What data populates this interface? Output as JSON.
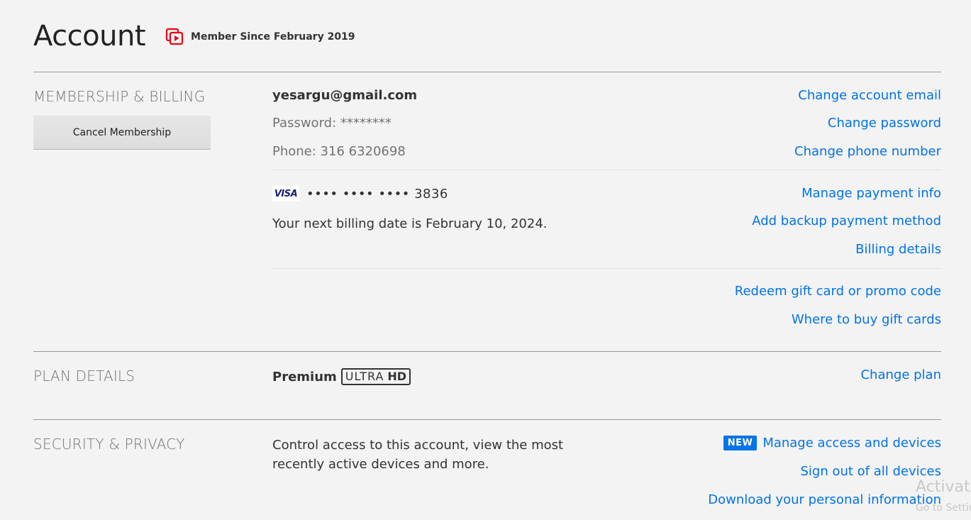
{
  "header": {
    "title": "Account",
    "member_since": "Member Since February 2019",
    "member_icon": "member-since-icon"
  },
  "membership": {
    "section_title": "MEMBERSHIP & BILLING",
    "cancel_label": "Cancel Membership",
    "email": "yesargu@gmail.com",
    "password": "Password: ********",
    "phone": "Phone: 316 6320698",
    "links": {
      "change_email": "Change account email",
      "change_password": "Change password",
      "change_phone": "Change phone number"
    }
  },
  "billing": {
    "card_brand": "VISA",
    "card_number": "•••• •••• •••• 3836",
    "next_billing": "Your next billing date is February 10, 2024.",
    "links": {
      "manage_payment": "Manage payment info",
      "add_backup": "Add backup payment method",
      "billing_details": "Billing details"
    }
  },
  "gift": {
    "links": {
      "redeem": "Redeem gift card or promo code",
      "where_to_buy": "Where to buy gift cards"
    }
  },
  "plan": {
    "section_title": "PLAN DETAILS",
    "name": "Premium",
    "badge_text": "ULTRA",
    "badge_hd": "HD",
    "change_plan": "Change plan"
  },
  "security": {
    "section_title": "SECURITY & PRIVACY",
    "description": "Control access to this account, view the most recently active devices and more.",
    "new_badge": "NEW",
    "links": {
      "manage_access": "Manage access and devices",
      "sign_out_all": "Sign out of all devices",
      "download_info": "Download your personal information"
    }
  },
  "watermark": {
    "line1": "Activate Windows",
    "line2": "Go to Settings to activate Windows."
  },
  "colors": {
    "background": "#f3f3f3",
    "link": "#0073e6",
    "brand_red": "#e50914",
    "section_title": "#737373"
  }
}
